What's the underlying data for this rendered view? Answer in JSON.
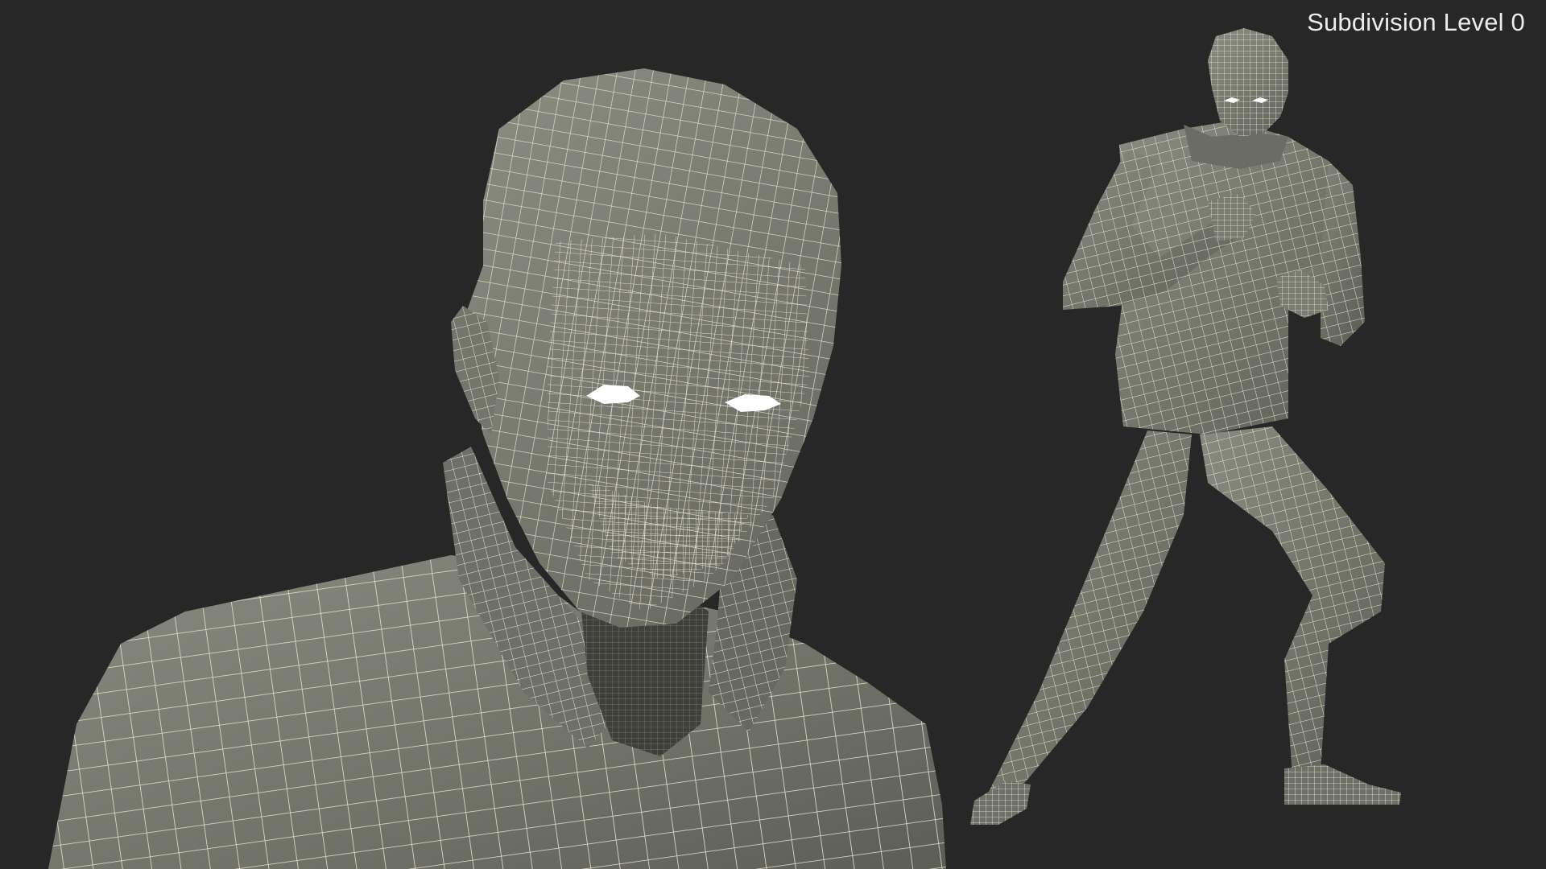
{
  "viewport": {
    "caption": "Subdivision Level 0",
    "background_color": "#272727"
  },
  "model": {
    "mesh_fill_color": "#7c7d73",
    "wire_color": "#e8e4cf",
    "eye_color": "#ffffff"
  }
}
